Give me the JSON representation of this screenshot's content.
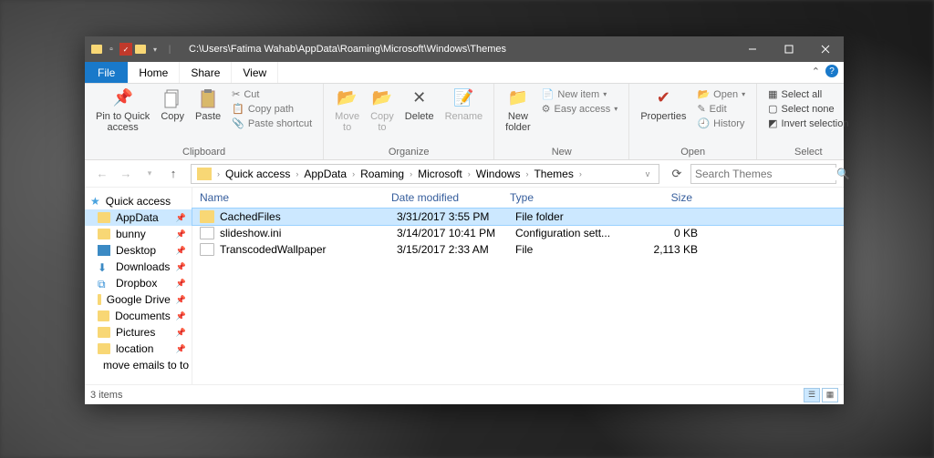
{
  "titlebar": {
    "path": "C:\\Users\\Fatima Wahab\\AppData\\Roaming\\Microsoft\\Windows\\Themes"
  },
  "tabs": {
    "file": "File",
    "home": "Home",
    "share": "Share",
    "view": "View"
  },
  "ribbon": {
    "clipboard": {
      "label": "Clipboard",
      "pin": "Pin to Quick\naccess",
      "copy": "Copy",
      "paste": "Paste",
      "cut": "Cut",
      "copypath": "Copy path",
      "shortcut": "Paste shortcut"
    },
    "organize": {
      "label": "Organize",
      "move": "Move\nto",
      "copyto": "Copy\nto",
      "delete": "Delete",
      "rename": "Rename"
    },
    "new": {
      "label": "New",
      "folder": "New\nfolder",
      "item": "New item",
      "easy": "Easy access"
    },
    "open": {
      "label": "Open",
      "properties": "Properties",
      "open": "Open",
      "edit": "Edit",
      "history": "History"
    },
    "select": {
      "label": "Select",
      "all": "Select all",
      "none": "Select none",
      "invert": "Invert selection"
    }
  },
  "breadcrumb": [
    "Quick access",
    "AppData",
    "Roaming",
    "Microsoft",
    "Windows",
    "Themes"
  ],
  "search": {
    "placeholder": "Search Themes"
  },
  "nav": {
    "quick": "Quick access",
    "items": [
      {
        "label": "AppData"
      },
      {
        "label": "bunny"
      },
      {
        "label": "Desktop"
      },
      {
        "label": "Downloads"
      },
      {
        "label": "Dropbox"
      },
      {
        "label": "Google Drive"
      },
      {
        "label": "Documents"
      },
      {
        "label": "Pictures"
      },
      {
        "label": "location"
      },
      {
        "label": "move emails to to"
      }
    ]
  },
  "columns": {
    "name": "Name",
    "date": "Date modified",
    "type": "Type",
    "size": "Size"
  },
  "files": [
    {
      "name": "CachedFiles",
      "date": "3/31/2017 3:55 PM",
      "type": "File folder",
      "size": "",
      "icon": "folder"
    },
    {
      "name": "slideshow.ini",
      "date": "3/14/2017 10:41 PM",
      "type": "Configuration sett...",
      "size": "0 KB",
      "icon": "file"
    },
    {
      "name": "TranscodedWallpaper",
      "date": "3/15/2017 2:33 AM",
      "type": "File",
      "size": "2,113 KB",
      "icon": "file"
    }
  ],
  "status": {
    "count": "3 items"
  }
}
